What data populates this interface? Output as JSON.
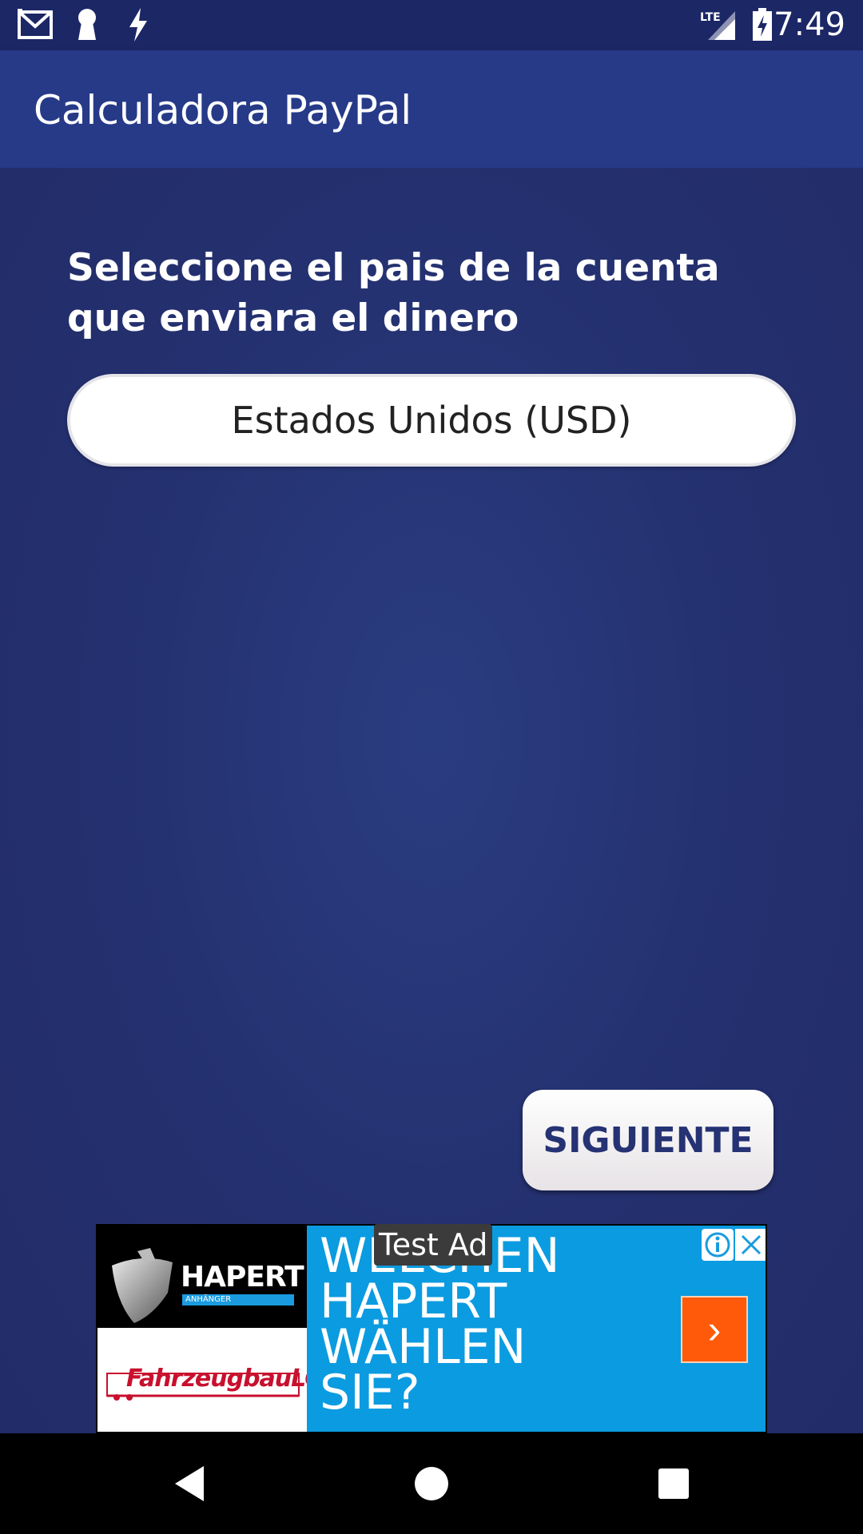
{
  "status_bar": {
    "time": "7:49",
    "left_icons": [
      "gmail-icon",
      "keyhole-icon",
      "flash-icon"
    ],
    "right_icons": [
      "lte-signal-icon",
      "battery-charging-icon"
    ],
    "network_label": "LTE"
  },
  "app_bar": {
    "title": "Calculadora PayPal"
  },
  "main": {
    "prompt": "Seleccione el pais de la cuenta que enviara el dinero",
    "country_select": {
      "selected": "Estados Unidos (USD)"
    },
    "next_button": "SIGUIENTE"
  },
  "ad": {
    "label": "Test Ad",
    "brand": "HAPERT",
    "brand_sub": "ANHÄNGER",
    "dealer": "FahrzeugbauLOWIS",
    "headline_lines": [
      "WELCHEN",
      "HAPERT",
      "WÄHLEN",
      "SIE?"
    ],
    "headline": "WELCHEN HAPERT WÄHLEN SIE?",
    "arrow": "›",
    "icons": [
      "info-icon",
      "close-icon"
    ]
  },
  "colors": {
    "status_bar": "#1c2766",
    "app_bar": "#263a88",
    "background": "#24306f",
    "button_text": "#253273",
    "ad_blue": "#0b9be0",
    "ad_orange": "#ff5a0a"
  },
  "nav_bar": {
    "buttons": [
      "back-icon",
      "home-icon",
      "recents-icon"
    ]
  }
}
